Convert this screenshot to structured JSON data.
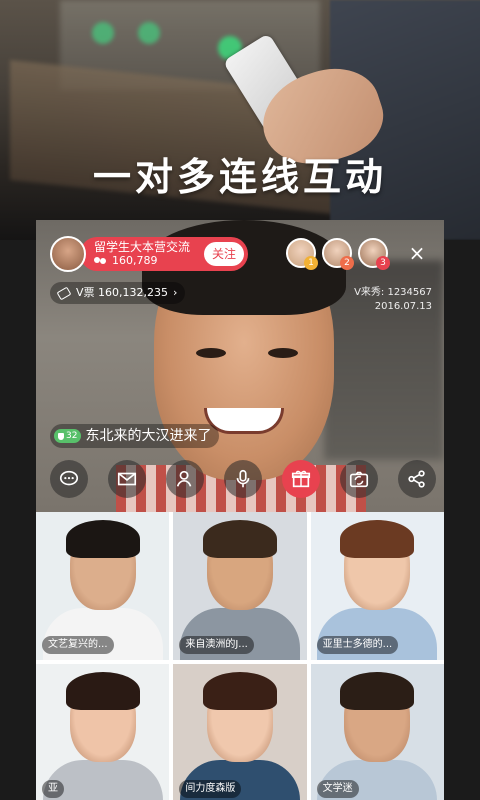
{
  "promo": {
    "title": "一对多连线互动"
  },
  "live": {
    "host": {
      "name": "留学生大本营交流",
      "fans": "160,789",
      "follow_label": "关注"
    },
    "viewers": [
      {
        "badge": "1",
        "badge_color": "#f2b134",
        "avatar_color": "#c9a27f"
      },
      {
        "badge": "2",
        "badge_color": "#ee6d4a",
        "avatar_color": "#b38a6d"
      },
      {
        "badge": "3",
        "badge_color": "#e8424f",
        "avatar_color": "#9a7054"
      }
    ],
    "close_icon": "close-icon",
    "vticket": {
      "label": "V票",
      "value": "160,132,235",
      "chevron": "›"
    },
    "id_text": "V来秀: 1234567",
    "date_text": "2016.07.13",
    "comment": {
      "level": "32",
      "text": "东北来的大汉进来了"
    },
    "toolbar_icons": [
      "chat-icon",
      "mail-icon",
      "users-icon",
      "mic-icon",
      "gift-icon",
      "camera-switch-icon",
      "share-icon"
    ]
  },
  "guests": [
    {
      "name": "文艺复兴的...",
      "bg": "#e9eef0",
      "skin": "#dcae8c",
      "hair": "#1b1613",
      "shirt": "#f4f4f4"
    },
    {
      "name": "来自澳洲的J...",
      "bg": "#d7dbe0",
      "skin": "#d8a67f",
      "hair": "#3b2a1d",
      "shirt": "#8c96a1"
    },
    {
      "name": "亚里士多德的...",
      "bg": "#e8eef3",
      "skin": "#efc7aa",
      "hair": "#6b3a22",
      "shirt": "#a9c2dc"
    },
    {
      "name": "亚",
      "bg": "#eef1f2",
      "skin": "#efc4a8",
      "hair": "#2a1a14",
      "shirt": "#bcc0c6"
    },
    {
      "name": "间力度森版",
      "bg": "#d8cfc8",
      "skin": "#f0c8ad",
      "hair": "#3a2016",
      "shirt": "#2f4f6f"
    },
    {
      "name": "文学迷",
      "bg": "#d7dfe6",
      "skin": "#d9a784",
      "hair": "#2b1e16",
      "shirt": "#b8c7d6"
    }
  ],
  "colors": {
    "accent": "#e8424f"
  }
}
